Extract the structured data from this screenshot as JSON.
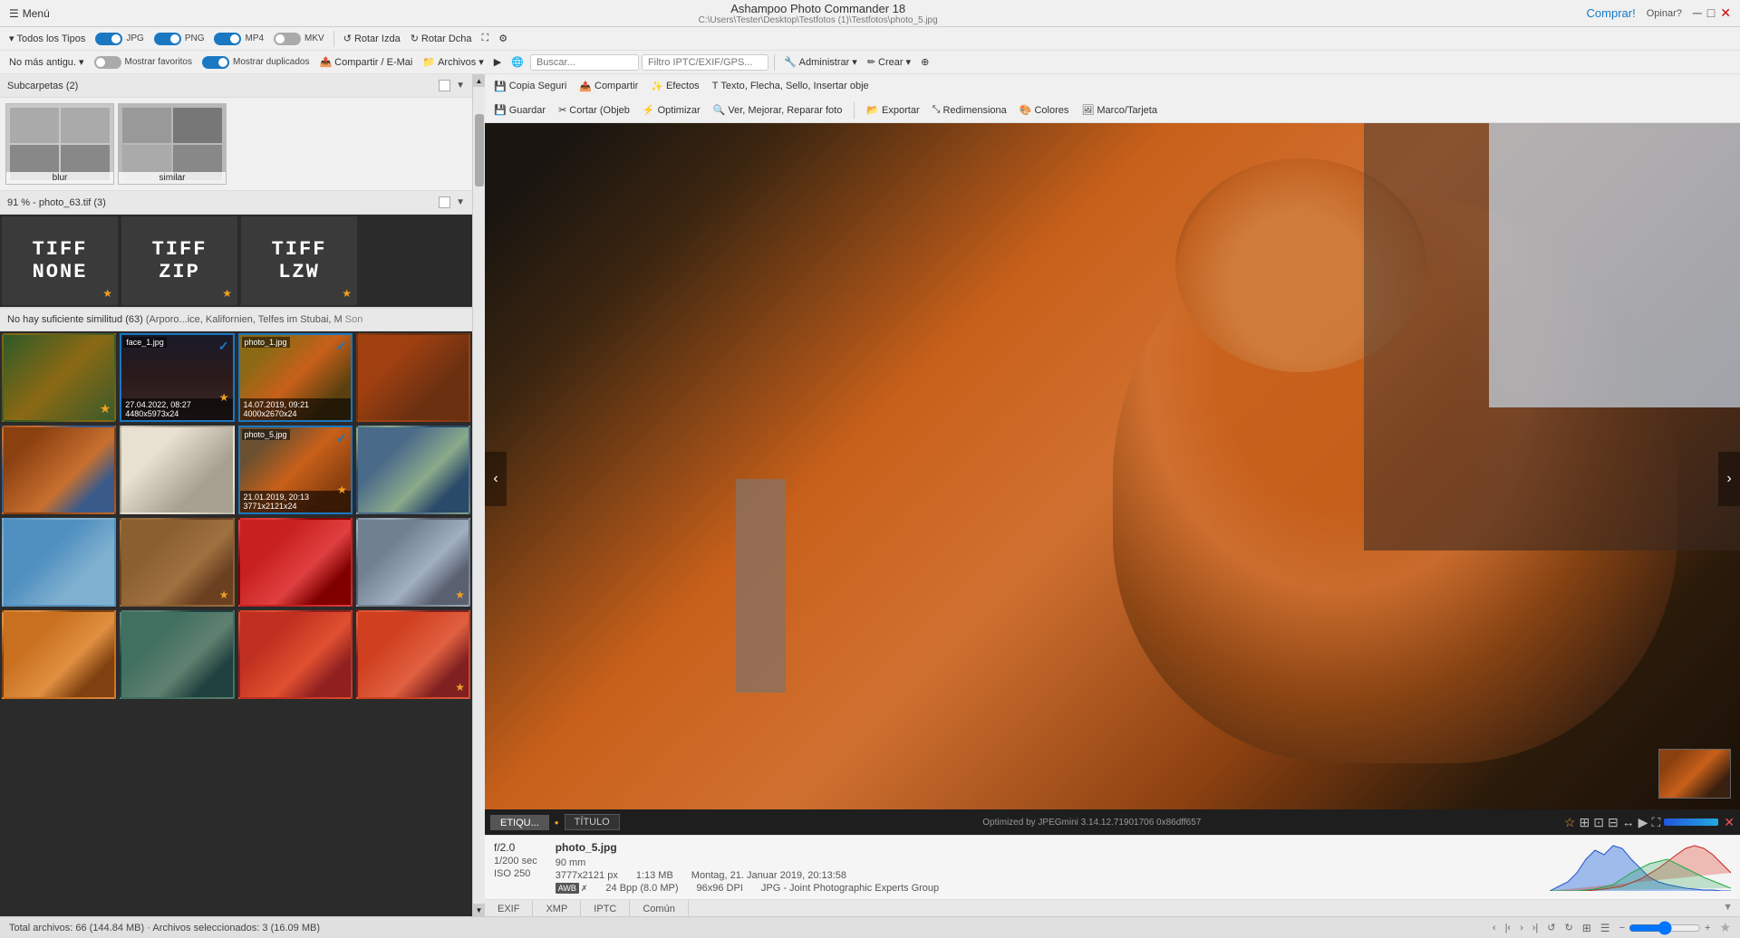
{
  "app": {
    "title": "Ashampoo Photo Commander 18",
    "comprar": "Comprar!",
    "opinar": "Opinar?",
    "filepath": "C:\\Users\\Tester\\Desktop\\Testfotos (1)\\Testfotos\\photo_5.jpg"
  },
  "menu": {
    "label": "Menú"
  },
  "toolbar1": {
    "tipos_label": "Todos los Tipos",
    "jpg_label": "JPG",
    "png_label": "PNG",
    "mp4_label": "MP4",
    "mkv_label": "MKV",
    "rotar_izda": "Rotar Izda",
    "rotar_dcha": "Rotar Dcha",
    "antiguedad": "No más antigu.",
    "mostrar_favoritos": "Mostrar favoritos",
    "mostrar_duplicados": "Mostrar duplicados",
    "compartir": "Compartir / E-Mai",
    "archivos": "Archivos",
    "buscar_placeholder": "Buscar...",
    "filtro_placeholder": "Filtro IPTC/EXIF/GPS...",
    "administrar": "Administrar",
    "crear": "Crear"
  },
  "toolbar2": {
    "copia_seguri": "Copia Seguri",
    "compartir": "Compartir",
    "efectos": "Efectos",
    "texto_flecha": "Texto, Flecha, Sello, Insertar obje",
    "guardar": "Guardar",
    "cortar": "Cortar (Objeb",
    "optimizar": "Optimizar",
    "ver_mejorar": "Ver, Mejorar, Reparar foto",
    "exportar": "Exportar",
    "redimensiona": "Redimensiona",
    "colores": "Colores",
    "marco": "Marco/Tarjeta"
  },
  "subcarpetas": {
    "title": "Subcarpetas (2)",
    "items": [
      {
        "label": "blur"
      },
      {
        "label": "similar"
      }
    ]
  },
  "group91": {
    "title": "91 % - photo_63.tif  (3)",
    "items": [
      {
        "line1": "TIFF",
        "line2": "NoNe"
      },
      {
        "line1": "TIFF",
        "line2": "ZIP"
      },
      {
        "line1": "TIFF",
        "line2": "LZW"
      }
    ]
  },
  "no_sim": {
    "title": "No hay suficiente similitud  (63)",
    "subtitle": "(Arporo...ice, Kalifornien, Telfes im Stubai, M",
    "more": "Son",
    "photos": [
      {
        "filename": "",
        "meta": "",
        "star": true,
        "selected": false
      },
      {
        "filename": "face_1.jpg",
        "meta": "27.04.2022, 08:27\n4480x5973x24",
        "star": true,
        "selected": true,
        "check": true
      },
      {
        "filename": "photo_1.jpg",
        "meta": "14.07.2019, 09:21\n4000x2670x24",
        "star": false,
        "selected": true,
        "check": true
      },
      {
        "filename": "",
        "meta": "",
        "star": false,
        "selected": false
      },
      {
        "filename": "",
        "meta": "",
        "star": false,
        "selected": false
      },
      {
        "filename": "",
        "meta": "",
        "star": false,
        "selected": false
      },
      {
        "filename": "photo_5.jpg",
        "meta": "21.01.2019, 20:13\n3771x2121x24",
        "star": true,
        "selected": true,
        "check": true
      },
      {
        "filename": "",
        "meta": "",
        "star": false,
        "selected": false
      },
      {
        "filename": "",
        "meta": "",
        "star": false,
        "selected": false
      },
      {
        "filename": "",
        "meta": "",
        "star": false,
        "selected": false
      },
      {
        "filename": "",
        "meta": "",
        "star": false,
        "selected": false
      },
      {
        "filename": "",
        "meta": "",
        "star": true,
        "selected": false
      }
    ]
  },
  "viewer": {
    "optimized_text": "Optimized by JPEGmini 3.14.12.71901706 0x86dff657",
    "tab_etiquetas": "ETIQU...",
    "tab_titulo": "TÍTULO",
    "tab_color_dot": "#f5a623"
  },
  "info_panel": {
    "aperture": "f/2.0",
    "shutter": "1/200 sec",
    "photo_name": "photo_5.jpg",
    "focal": "90 mm",
    "iso": "ISO 250",
    "dimensions": "3777x2121 px",
    "filesize": "1:13 MB",
    "date": "Montag, 21. Januar 2019, 20:13:58",
    "bpp": "24 Bpp (8.0 MP)",
    "dpi": "96x96 DPI",
    "format": "JPG - Joint Photographic Experts Group",
    "awb": "AWB",
    "tabs": [
      "EXIF",
      "XMP",
      "IPTC",
      "Común"
    ]
  },
  "status_bar": {
    "total": "Total archivos: 66 (144.84 MB) · Archivos seleccionados: 3 (16.09 MB)",
    "zoom_minus": "−",
    "zoom_plus": "+"
  }
}
